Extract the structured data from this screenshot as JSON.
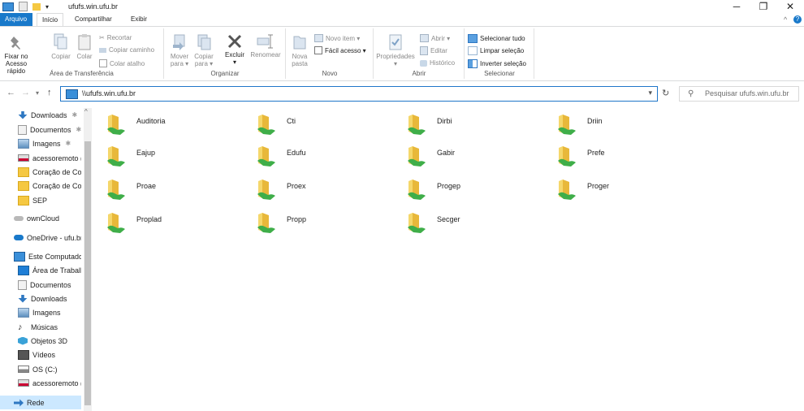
{
  "window": {
    "title": "ufufs.win.ufu.br",
    "qat_dropdown": "▾",
    "minimize": "─",
    "restore": "❐",
    "close": "✕",
    "ribbon_collapse": "^",
    "help": "?"
  },
  "ribbon_tabs": [
    "Arquivo",
    "Início",
    "Compartilhar",
    "Exibir"
  ],
  "ribbon": {
    "clipboard": {
      "title": "Área de Transferência",
      "pin_line1": "Fixar no",
      "pin_line2": "Acesso rápido",
      "copy": "Copiar",
      "paste": "Colar",
      "cut": "Recortar",
      "copy_path": "Copiar caminho",
      "paste_shortcut": "Colar atalho"
    },
    "organize": {
      "title": "Organizar",
      "move_line1": "Mover",
      "move_line2": "para ▾",
      "copyto_line1": "Copiar",
      "copyto_line2": "para ▾",
      "delete": "Excluir",
      "delete_arrow": "▾",
      "rename": "Renomear"
    },
    "new": {
      "title": "Novo",
      "folder_line1": "Nova",
      "folder_line2": "pasta",
      "new_item": "Novo item ▾",
      "easy_access": "Fácil acesso ▾"
    },
    "open": {
      "title": "Abrir",
      "properties": "Propriedades",
      "properties_arrow": "▾",
      "open": "Abrir ▾",
      "edit": "Editar",
      "history": "Histórico"
    },
    "select": {
      "title": "Selecionar",
      "select_all": "Selecionar tudo",
      "select_none": "Limpar seleção",
      "invert": "Inverter seleção"
    }
  },
  "address": {
    "back": "←",
    "forward": "→",
    "recent": "▾",
    "up": "↑",
    "path": "\\\\ufufs.win.ufu.br",
    "dropdown": "▾",
    "refresh": "↻",
    "search_placeholder": "Pesquisar ufufs.win.ufu.br"
  },
  "nav_pane": [
    {
      "label": "Downloads",
      "icon": "download-icon",
      "pinned": true
    },
    {
      "label": "Documentos",
      "icon": "document-icon",
      "pinned": true
    },
    {
      "label": "Imagens",
      "icon": "pictures-icon",
      "pinned": true
    },
    {
      "label": "acessoremoto (\\",
      "icon": "network-drive-icon",
      "pinned": false
    },
    {
      "label": "Coração de Corr",
      "icon": "folder-icon",
      "pinned": false
    },
    {
      "label": "Coração de Corr",
      "icon": "folder-icon",
      "pinned": false
    },
    {
      "label": "SEP",
      "icon": "folder-icon",
      "pinned": false
    },
    {
      "label": "ownCloud",
      "icon": "cloud-icon",
      "pinned": false
    },
    {
      "label": "OneDrive - ufu.br",
      "icon": "onedrive-icon",
      "pinned": false
    },
    {
      "label": "Este Computador",
      "icon": "computer-icon",
      "pinned": false
    },
    {
      "label": "Área de Trabalho",
      "icon": "desktop-icon",
      "pinned": false
    },
    {
      "label": "Documentos",
      "icon": "document-icon",
      "pinned": false
    },
    {
      "label": "Downloads",
      "icon": "download-icon",
      "pinned": false
    },
    {
      "label": "Imagens",
      "icon": "pictures-icon",
      "pinned": false
    },
    {
      "label": "Músicas",
      "icon": "music-icon",
      "pinned": false
    },
    {
      "label": "Objetos 3D",
      "icon": "cube-icon",
      "pinned": false
    },
    {
      "label": "Vídeos",
      "icon": "video-icon",
      "pinned": false
    },
    {
      "label": "OS (C:)",
      "icon": "drive-icon",
      "pinned": false
    },
    {
      "label": "acessoremoto (\\",
      "icon": "network-drive-icon",
      "pinned": false
    },
    {
      "label": "Rede",
      "icon": "network-icon",
      "pinned": false,
      "selected": true
    }
  ],
  "folders": [
    "Auditoria",
    "Cti",
    "Dirbi",
    "Driin",
    "Eajup",
    "Edufu",
    "Gabir",
    "Prefe",
    "Proae",
    "Proex",
    "Progep",
    "Proger",
    "Proplad",
    "Propp",
    "Secger"
  ],
  "colors": {
    "accent": "#1979ca",
    "folder": "#f5c842",
    "share": "#3fae49",
    "selection": "#cce8ff"
  }
}
